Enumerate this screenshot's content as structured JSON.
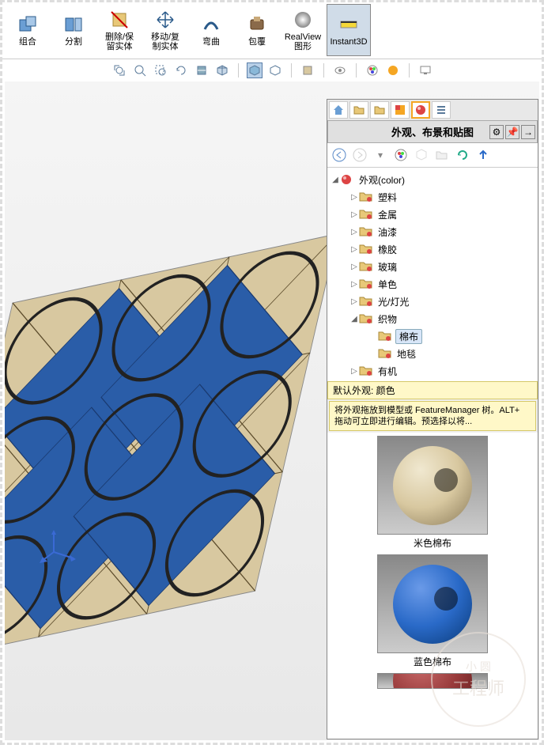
{
  "ribbon": {
    "combine": "组合",
    "split": "分割",
    "delete_keep": "删除/保\n留实体",
    "move_copy": "移动/复\n制实体",
    "flex": "弯曲",
    "wrap": "包覆",
    "realview": "RealView\n图形",
    "instant3d": "Instant3D"
  },
  "panel": {
    "title": "外观、布景和贴图",
    "tree_root": "外观(color)",
    "nodes": {
      "plastic": "塑料",
      "metal": "金属",
      "paint": "油漆",
      "rubber": "橡胶",
      "glass": "玻璃",
      "solid": "单色",
      "light": "光/灯光",
      "fabric": "织物",
      "cotton": "棉布",
      "carpet": "地毯",
      "organic": "有机"
    },
    "default_label": "默认外观: 颜色",
    "tip": "将外观拖放到模型或 FeatureManager 树。ALT+ 拖动可立即进行编辑。预选择以将...",
    "swatch1": "米色棉布",
    "swatch2": "蓝色棉布"
  },
  "colors": {
    "beige": "#d8c8a0",
    "blue": "#2a5da8",
    "darkblue": "#1a3a70"
  },
  "watermark": {
    "l1": "小 圆",
    "l2": "工程师"
  }
}
